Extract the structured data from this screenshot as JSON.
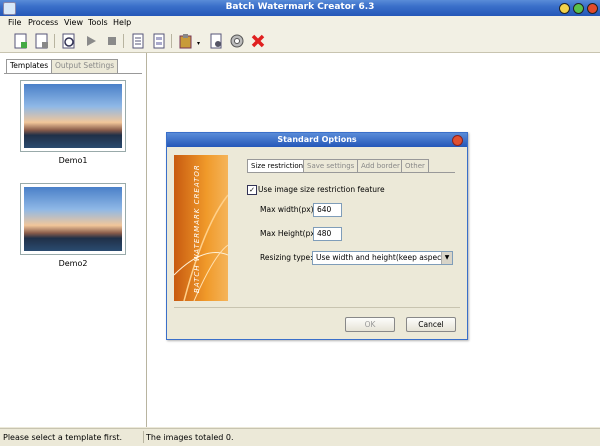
{
  "window": {
    "title": "Batch Watermark Creator 6.3"
  },
  "menu": {
    "file": "File",
    "process": "Process",
    "view": "View",
    "tools": "Tools",
    "help": "Help"
  },
  "toolbar": {
    "icons": [
      "new-template-icon",
      "close-template-icon",
      "preview-icon",
      "run-icon",
      "stop-icon",
      "document-icon",
      "document-list-icon",
      "clipboard-icon",
      "page-icon",
      "settings-icon",
      "delete-icon"
    ],
    "colors": {
      "delete": "#e02020"
    }
  },
  "left_panel": {
    "tabs": [
      "Templates",
      "Output Settings"
    ],
    "active_tab": "Templates",
    "templates": [
      {
        "name": "Demo1"
      },
      {
        "name": "Demo2"
      }
    ]
  },
  "dialog": {
    "title": "Standard Options",
    "banner_text": "BATCH WATERMARK CREATOR",
    "tabs": [
      "Size restriction",
      "Save settings",
      "Add border",
      "Other"
    ],
    "active_tab": "Size restriction",
    "use_restriction_label": "Use image size restriction feature",
    "use_restriction_checked": true,
    "max_width_label": "Max width(px)",
    "max_width_value": "640",
    "max_height_label": "Max Height(px)",
    "max_height_value": "480",
    "resizing_label": "Resizing type:",
    "resizing_value": "Use width and height(keep aspect)",
    "ok_label": "OK",
    "cancel_label": "Cancel"
  },
  "status": {
    "left": "Please select a template first.",
    "right": "The images totaled 0."
  }
}
